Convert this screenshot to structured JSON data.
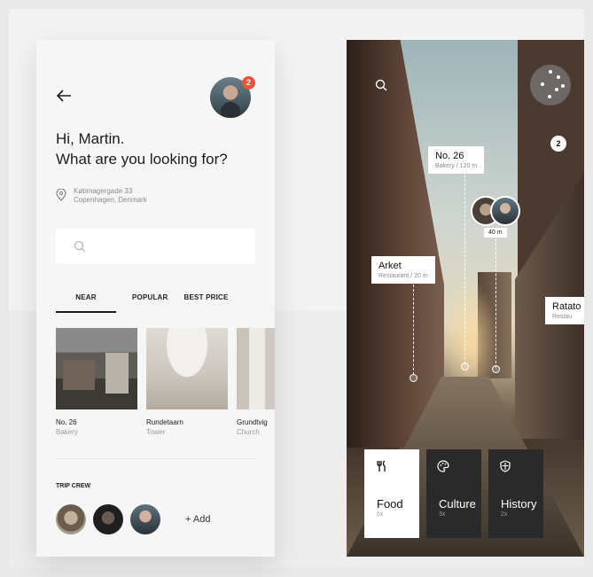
{
  "left_screen": {
    "greeting_line1": "Hi, Martin.",
    "greeting_line2": "What are you looking for?",
    "notification_count": "2",
    "address_line1": "Købmagergade 33",
    "address_line2": "Copenhagen, Denmark",
    "search_placeholder": "",
    "tabs": [
      {
        "label": "NEAR",
        "active": true
      },
      {
        "label": "POPULAR",
        "active": false
      },
      {
        "label": "BEST PRICE",
        "active": false
      }
    ],
    "places": [
      {
        "name": "No. 26",
        "type": "Bakery"
      },
      {
        "name": "Rundetaarn",
        "type": "Tower"
      },
      {
        "name": "Grundtvig",
        "type": "Church"
      }
    ],
    "crew_title": "TRIP CREW",
    "add_label": "+ Add"
  },
  "right_screen": {
    "ar_count": "2",
    "labels": [
      {
        "title": "No. 26",
        "subtitle": "Bakery / 120 m"
      },
      {
        "title": "Arket",
        "subtitle": "Restaurant / 20 m"
      },
      {
        "title": "Ratato",
        "subtitle": "Restau"
      }
    ],
    "friend_distance": "40 m",
    "categories": [
      {
        "name": "Food",
        "count": "6x",
        "icon": "fork-knife-icon",
        "active": true
      },
      {
        "name": "Culture",
        "count": "3x",
        "icon": "palette-icon",
        "active": false
      },
      {
        "name": "History",
        "count": "2x",
        "icon": "shield-icon",
        "active": false
      }
    ]
  },
  "colors": {
    "badge": "#e5543b",
    "dark_tile": "#2a2a2a",
    "text": "#1c1c1c"
  }
}
